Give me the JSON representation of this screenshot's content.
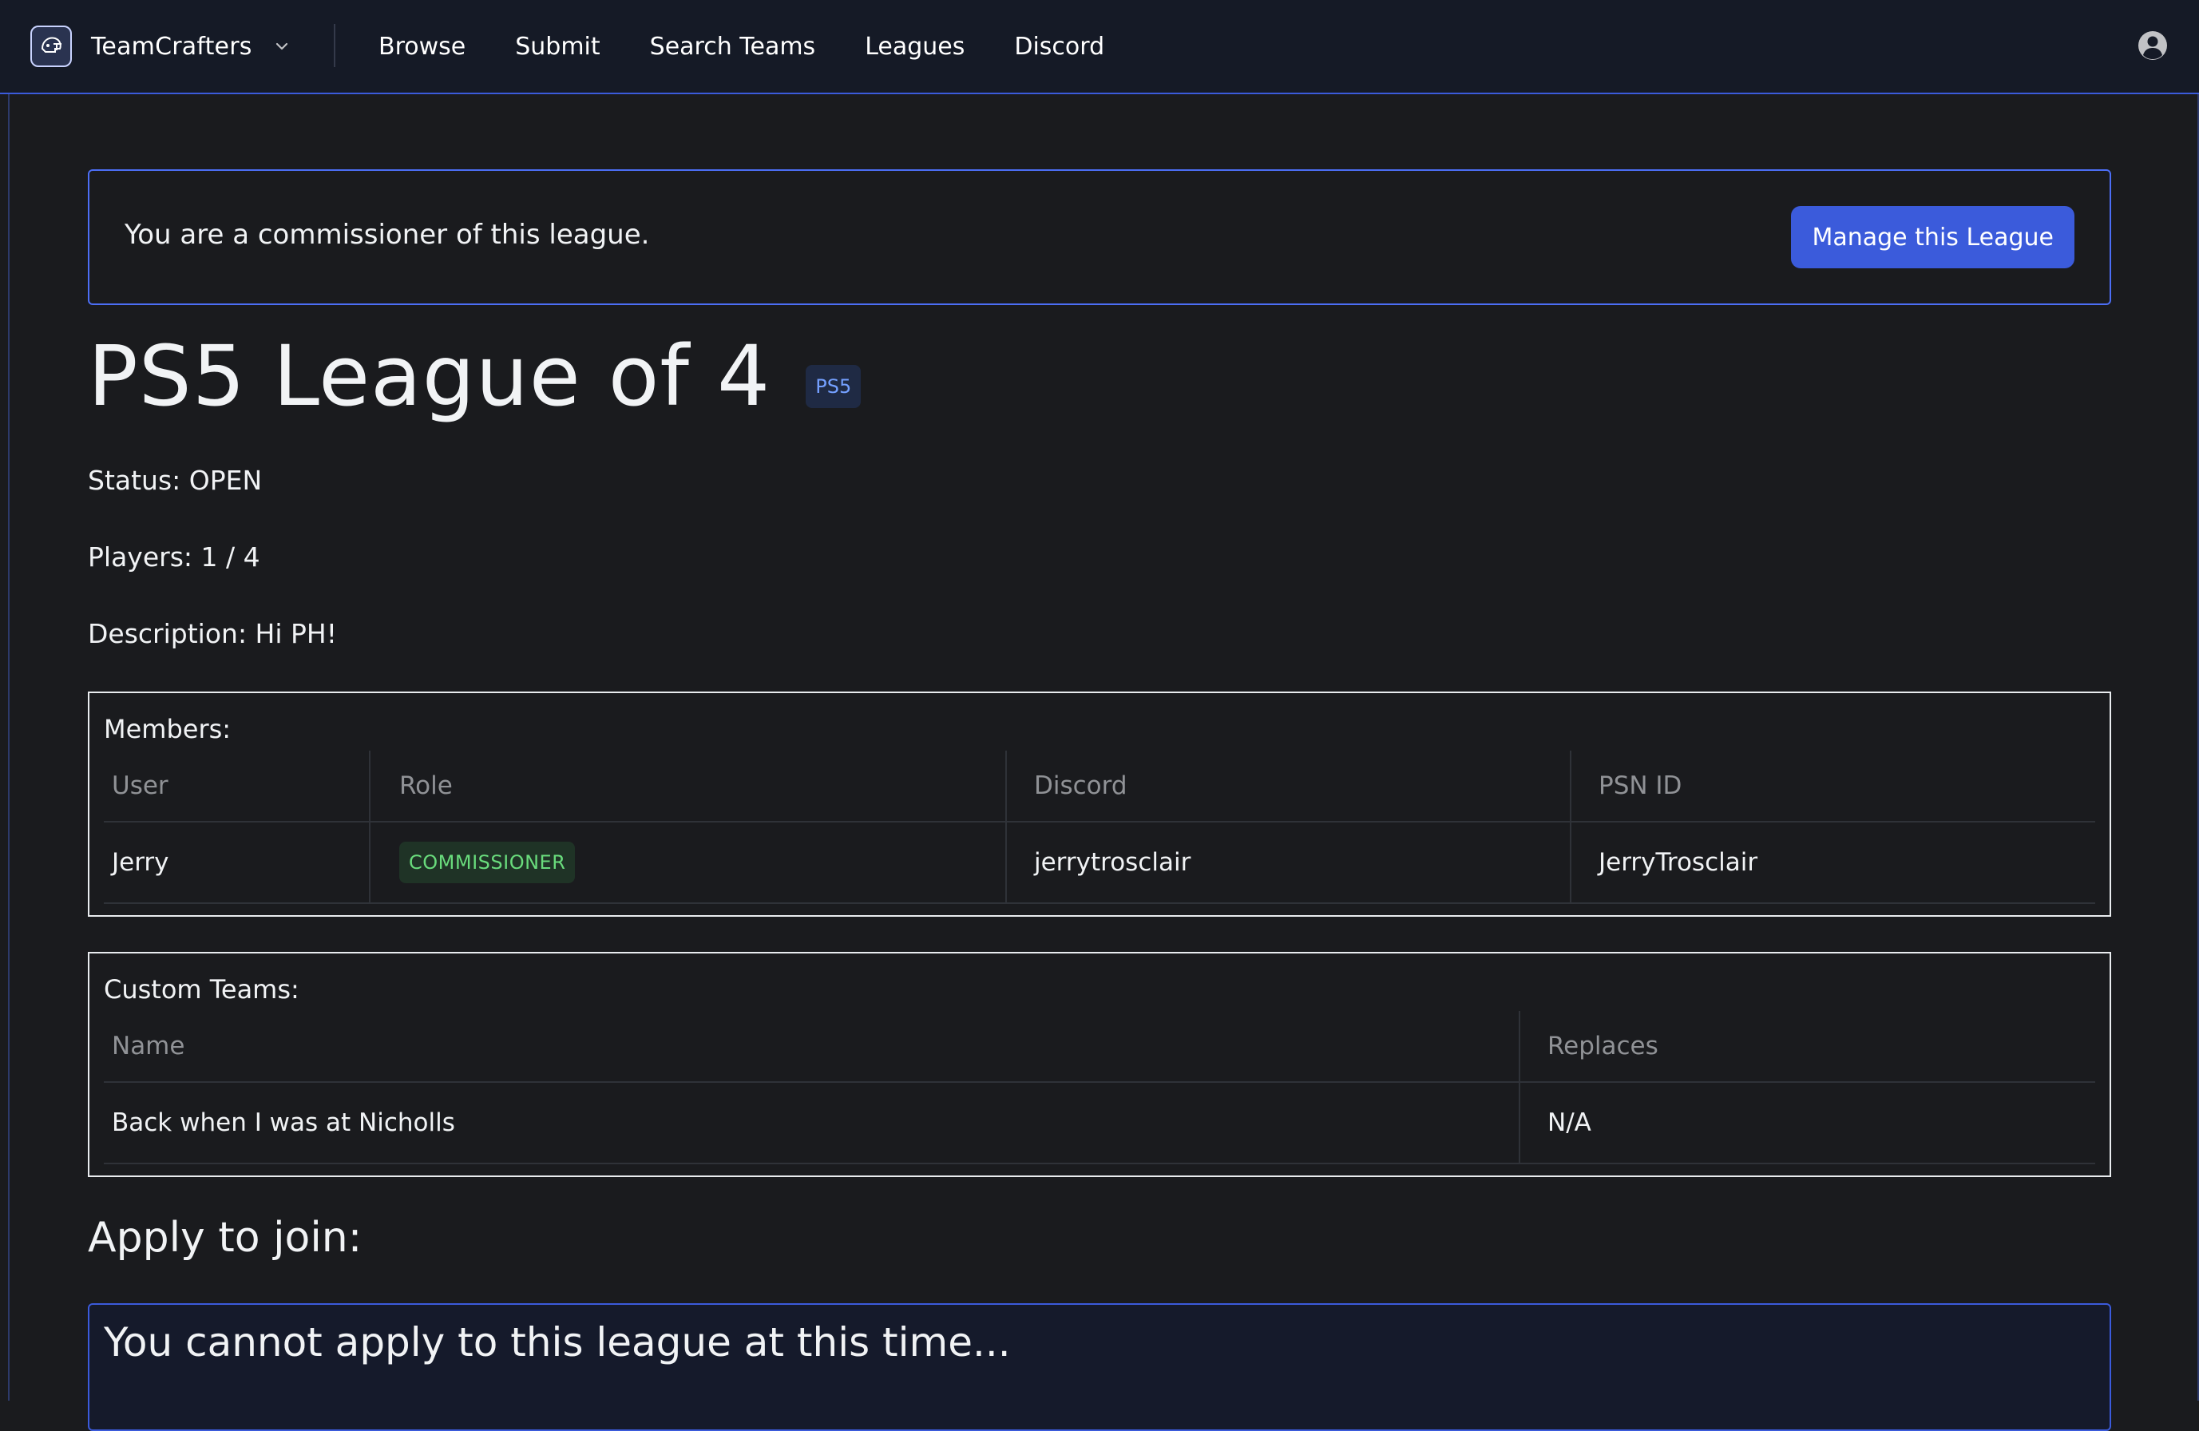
{
  "header": {
    "brand": "TeamCrafters",
    "nav": [
      "Browse",
      "Submit",
      "Search Teams",
      "Leagues",
      "Discord"
    ]
  },
  "notice": {
    "text": "You are a commissioner of this league.",
    "manage_label": "Manage this League"
  },
  "league": {
    "title": "PS5 League of 4",
    "platform": "PS5",
    "status": "Status: OPEN",
    "players": "Players: 1 / 4",
    "description": "Description: Hi PH!"
  },
  "members": {
    "title": "Members:",
    "columns": [
      "User",
      "Role",
      "Discord",
      "PSN ID"
    ],
    "rows": [
      {
        "user": "Jerry",
        "role": "COMMISSIONER",
        "discord": "jerrytrosclair",
        "psn": "JerryTrosclair"
      }
    ]
  },
  "custom_teams": {
    "title": "Custom Teams:",
    "columns": [
      "Name",
      "Replaces"
    ],
    "rows": [
      {
        "name": "Back when I was at Nicholls",
        "replaces": "N/A"
      }
    ]
  },
  "apply": {
    "heading": "Apply to join:",
    "message": "You cannot apply to this league at this time..."
  },
  "colors": {
    "accent": "#3b5bdb",
    "background": "#1a1b1e",
    "header": "#151a26",
    "badge_green": "#69db7c",
    "badge_blue": "#74a0ff"
  }
}
